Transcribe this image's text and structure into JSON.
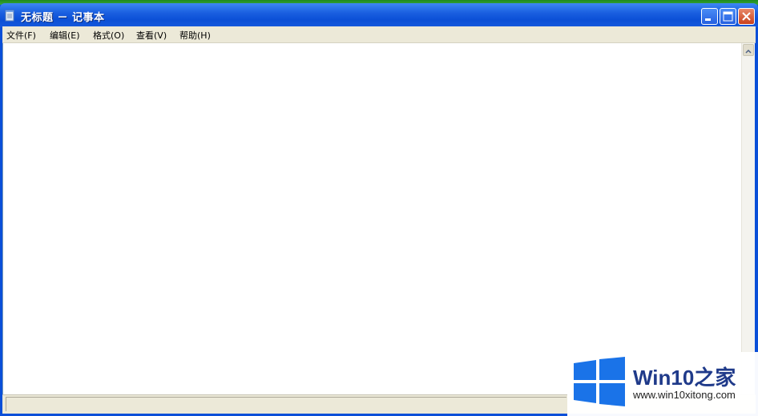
{
  "window": {
    "title": "无标题 － 记事本"
  },
  "menubar": {
    "items": [
      {
        "label": "文件(F)"
      },
      {
        "label": "编辑(E)"
      },
      {
        "label": "格式(O)"
      },
      {
        "label": "查看(V)"
      },
      {
        "label": "帮助(H)"
      }
    ]
  },
  "editor": {
    "content": ""
  },
  "watermark": {
    "title": "Win10之家",
    "url": "www.win10xitong.com"
  },
  "colors": {
    "titlebar": "#0b4fd6",
    "menubar": "#ece9d8",
    "watermark_text": "#1f3a8a",
    "windows_logo": "#1a73e8"
  },
  "icons": {
    "app": "notepad-icon",
    "minimize": "minimize-icon",
    "maximize": "maximize-icon",
    "close": "close-icon",
    "scroll_up": "scroll-up-arrow-icon",
    "logo": "windows-logo-icon"
  }
}
